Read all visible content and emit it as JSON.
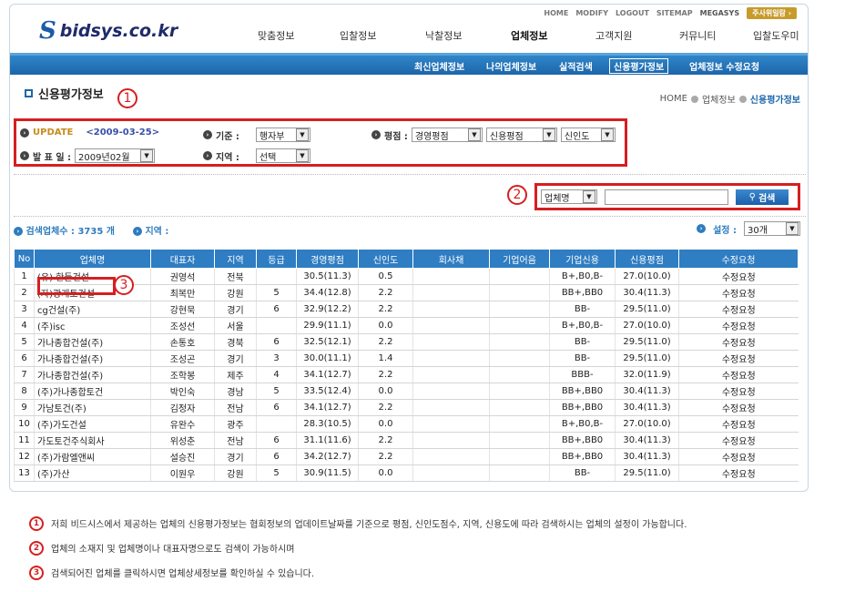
{
  "header": {
    "top_links": [
      "HOME",
      "MODIFY",
      "LOGOUT",
      "SITEMAP",
      "MEGASYS"
    ],
    "top_button": "주사위일람 ›",
    "logo_text": "bidsys.co.kr",
    "main_nav": [
      {
        "label": "맞춤정보"
      },
      {
        "label": "입찰정보"
      },
      {
        "label": "낙찰정보"
      },
      {
        "label": "업체정보"
      },
      {
        "label": "고객지원"
      },
      {
        "label": "커뮤니티"
      },
      {
        "label": "입찰도우미"
      }
    ],
    "sub_nav": [
      "최신업체정보",
      "나의업체정보",
      "실적검색",
      "신용평가정보",
      "업체정보 수정요청"
    ]
  },
  "page": {
    "title": "신용평가정보",
    "breadcrumb": [
      "HOME",
      "업체정보",
      "신용평가정보"
    ]
  },
  "filters": {
    "update_label": "UPDATE",
    "update_value": "<2009-03-25>",
    "standard_label": "기준 :",
    "standard_value": "행자부",
    "rating_label": "평점 :",
    "rating_selects": [
      "경영평점",
      "신용평점",
      "신인도"
    ],
    "announce_label": "발 표 일 :",
    "announce_value": "2009년02월",
    "region_label": "지역 :",
    "region_value": "선택"
  },
  "search": {
    "field_select": "업체명",
    "button_label": "검색"
  },
  "results": {
    "count_label": "검색업체수 : 3735 개",
    "region_label": "지역 :",
    "settings_label": "설정 :",
    "per_page": "30개"
  },
  "annotations": {
    "one": "1",
    "two": "2",
    "three": "3"
  },
  "table": {
    "headers": [
      "No",
      "업체명",
      "대표자",
      "지역",
      "등급",
      "경영평점",
      "신인도",
      "회사채",
      "기업어음",
      "기업신용",
      "신용평점",
      "수정요청"
    ],
    "rows": [
      [
        "1",
        "(유) 한들건설",
        "권영석",
        "전북",
        "",
        "30.5(11.3)",
        "0.5",
        "",
        "",
        "B+,B0,B-",
        "27.0(10.0)",
        "수정요청"
      ],
      [
        "2",
        "(자)광개토건설",
        "최복만",
        "강원",
        "5",
        "34.4(12.8)",
        "2.2",
        "",
        "",
        "BB+,BB0",
        "30.4(11.3)",
        "수정요청"
      ],
      [
        "3",
        "cg건설(주)",
        "강현묵",
        "경기",
        "6",
        "32.9(12.2)",
        "2.2",
        "",
        "",
        "BB-",
        "29.5(11.0)",
        "수정요청"
      ],
      [
        "4",
        "(주)isc",
        "조성선",
        "서울",
        "",
        "29.9(11.1)",
        "0.0",
        "",
        "",
        "B+,B0,B-",
        "27.0(10.0)",
        "수정요청"
      ],
      [
        "5",
        "가나종합건설(주)",
        "손통호",
        "경북",
        "6",
        "32.5(12.1)",
        "2.2",
        "",
        "",
        "BB-",
        "29.5(11.0)",
        "수정요청"
      ],
      [
        "6",
        "가나종합건설(주)",
        "조성곤",
        "경기",
        "3",
        "30.0(11.1)",
        "1.4",
        "",
        "",
        "BB-",
        "29.5(11.0)",
        "수정요청"
      ],
      [
        "7",
        "가나종합건설(주)",
        "조학봉",
        "제주",
        "4",
        "34.1(12.7)",
        "2.2",
        "",
        "",
        "BBB-",
        "32.0(11.9)",
        "수정요청"
      ],
      [
        "8",
        "(주)가나종합토건",
        "박인숙",
        "경남",
        "5",
        "33.5(12.4)",
        "0.0",
        "",
        "",
        "BB+,BB0",
        "30.4(11.3)",
        "수정요청"
      ],
      [
        "9",
        "가남토건(주)",
        "김정자",
        "전남",
        "6",
        "34.1(12.7)",
        "2.2",
        "",
        "",
        "BB+,BB0",
        "30.4(11.3)",
        "수정요청"
      ],
      [
        "10",
        "(주)가도건설",
        "유완수",
        "광주",
        "",
        "28.3(10.5)",
        "0.0",
        "",
        "",
        "B+,B0,B-",
        "27.0(10.0)",
        "수정요청"
      ],
      [
        "11",
        "가도토건주식회사",
        "위성춘",
        "전남",
        "6",
        "31.1(11.6)",
        "2.2",
        "",
        "",
        "BB+,BB0",
        "30.4(11.3)",
        "수정요청"
      ],
      [
        "12",
        "(주)가람엘앤씨",
        "설승진",
        "경기",
        "6",
        "34.2(12.7)",
        "2.2",
        "",
        "",
        "BB+,BB0",
        "30.4(11.3)",
        "수정요청"
      ],
      [
        "13",
        "(주)가산",
        "이원우",
        "강원",
        "5",
        "30.9(11.5)",
        "0.0",
        "",
        "",
        "BB-",
        "29.5(11.0)",
        "수정요청"
      ]
    ]
  },
  "notes": [
    {
      "num": "1",
      "text": "저희 비드시스에서 제공하는 업체의 신용평가정보는 협회정보의 업데이트날짜를 기준으로 평점, 신인도점수, 지역, 신용도에 따라 검색하시는 업체의 설정이 가능합니다."
    },
    {
      "num": "2",
      "text": "업체의 소재지 및 업체명이나 대표자명으로도 검색이 가능하시며"
    },
    {
      "num": "3",
      "text": "검색되어진 업체를 클릭하시면 업체상세정보를 확인하실 수 있습니다."
    }
  ]
}
